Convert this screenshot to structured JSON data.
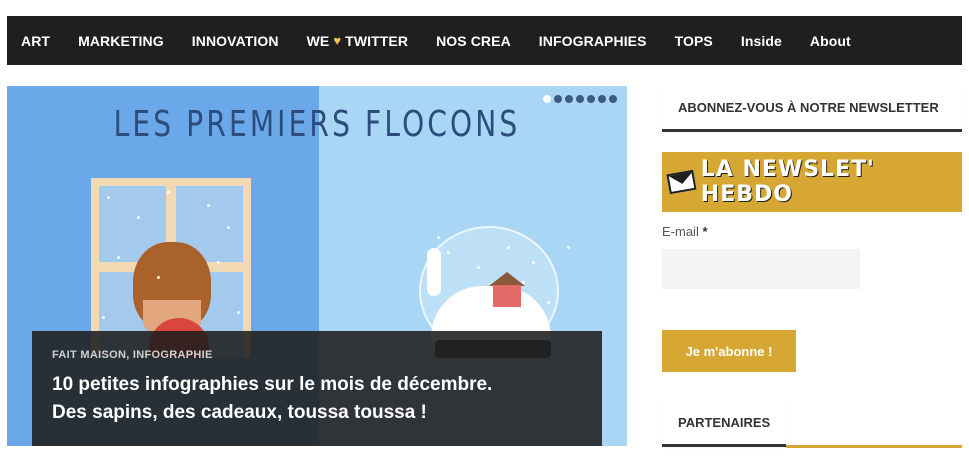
{
  "nav": {
    "items": [
      {
        "label": "ART"
      },
      {
        "label": "MARKETING"
      },
      {
        "label": "INNOVATION"
      },
      {
        "label_pre": "WE",
        "label_post": "TWITTER"
      },
      {
        "label": "NOS CREA"
      },
      {
        "label": "INFOGRAPHIES"
      },
      {
        "label": "TOPS"
      },
      {
        "label": "Inside"
      },
      {
        "label": "About"
      }
    ]
  },
  "hero": {
    "image_title": "LES PREMIERS FLOCONS",
    "slide_count": 7,
    "active_slide": 1,
    "categories": "FAIT MAISON, INFOGRAPHIE",
    "title_line1": "10 petites infographies sur le mois de décembre.",
    "title_line2": "Des sapins, des cadeaux, toussa toussa !"
  },
  "sidebar": {
    "newsletter_heading": "ABONNEZ-VOUS À NOTRE NEWSLETTER",
    "newsletter_banner": "LA NEWSLET' HEBDO",
    "email_label": "E-mail",
    "required_mark": "*",
    "email_value": "",
    "subscribe_label": "Je m'abonne !",
    "partners_heading": "PARTENAIRES"
  },
  "colors": {
    "nav_bg": "#1f1f1f",
    "accent": "#d6a833",
    "heart": "#f2c14e"
  }
}
